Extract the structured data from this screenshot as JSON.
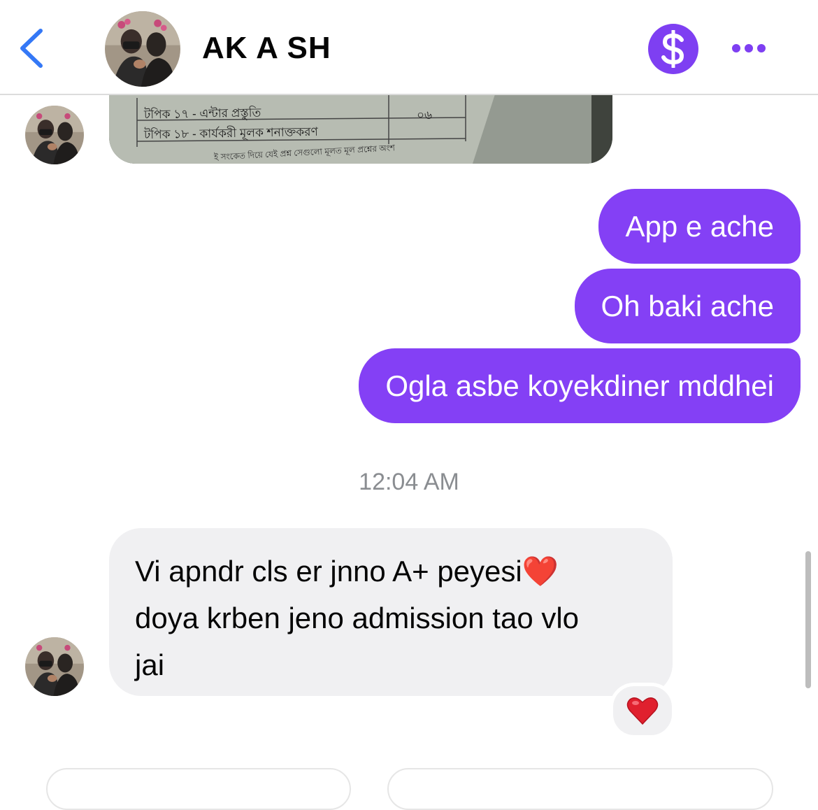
{
  "header": {
    "contact_name": "AK A SH",
    "colors": {
      "accent_blue": "#3478f6",
      "accent_purple": "#7e3ff2"
    },
    "icons": [
      "chevron-left-icon",
      "dollar-icon",
      "more-dots-icon"
    ]
  },
  "image_message": {
    "table_rows": [
      {
        "label": "টপিক ১৭ - এন্টার প্রস্তুতি",
        "value": "০৬"
      },
      {
        "label": "টপিক ১৮ - কার্যকরী মূলক শনাক্তকরণ",
        "value": ""
      }
    ],
    "footer_text": "ই সংকেত দিয়ে যেই প্রশ্ন সেগুলো মূলত মূল প্রশ্নের অংশ"
  },
  "messages": {
    "sent": [
      {
        "text": "App e ache"
      },
      {
        "text": "Oh baki ache"
      },
      {
        "text": "Ogla asbe koyekdiner mddhei"
      }
    ],
    "timestamp": "12:04 AM",
    "received": {
      "lines": [
        "Vi apndr cls er jnno A+ peyesi❤️",
        "doya krben jeno admission tao vlo",
        "jai"
      ],
      "reaction": "❤️"
    }
  },
  "colors": {
    "sent_bubble": "#8440f5",
    "received_bubble": "#f0f0f2",
    "timestamp": "#8a8d91"
  }
}
